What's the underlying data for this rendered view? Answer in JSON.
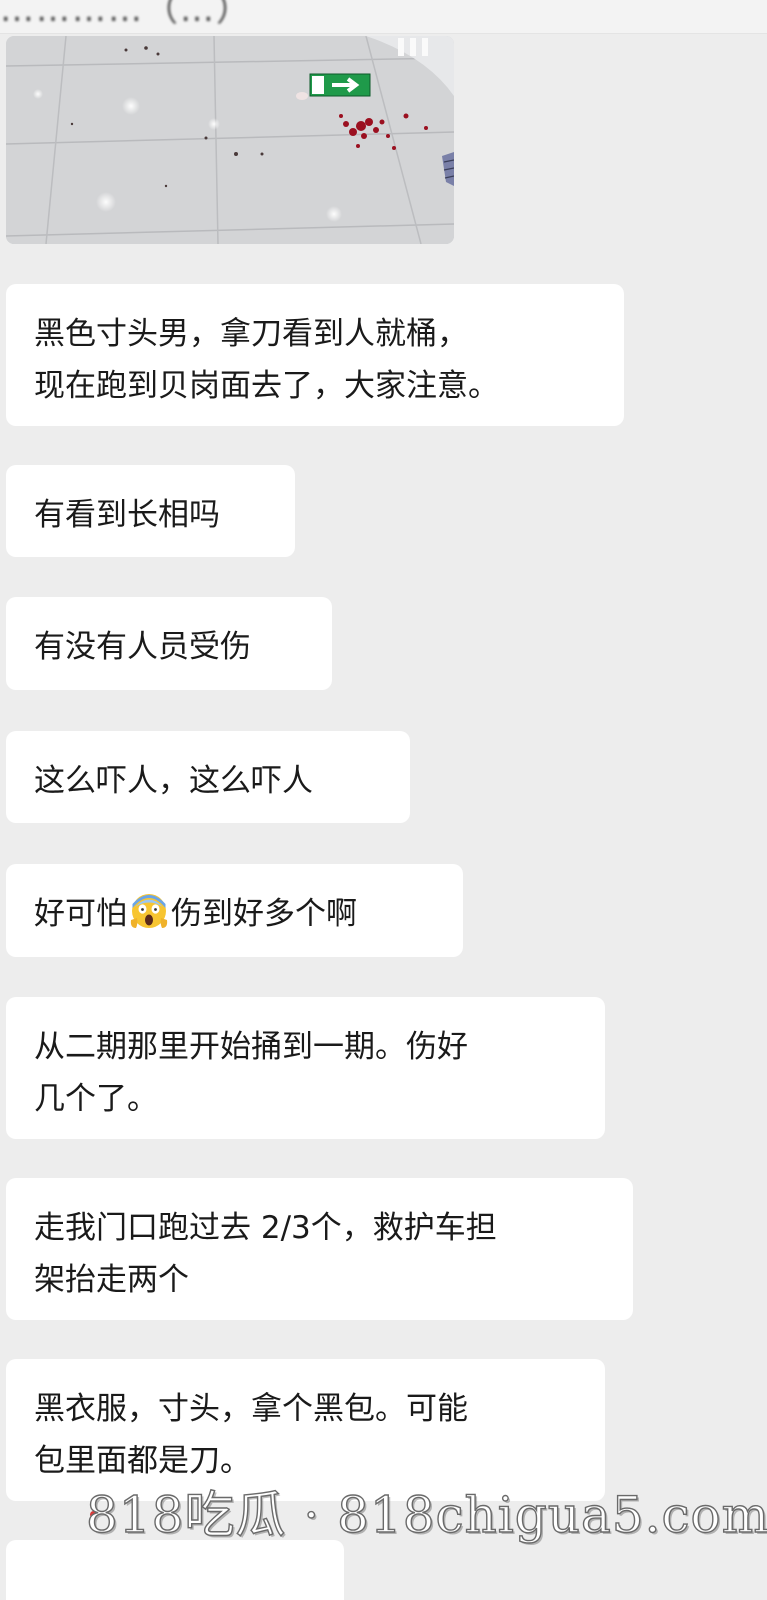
{
  "header": {
    "title_cut": "…………（…）"
  },
  "photo": {
    "alt": ""
  },
  "messages": [
    {
      "lines": [
        "黑色寸头男，拿刀看到人就桶，",
        "现在跑到贝岗面去了，大家注意。"
      ]
    },
    {
      "lines": [
        "有看到长相吗"
      ]
    },
    {
      "lines": [
        "有没有人员受伤"
      ]
    },
    {
      "lines": [
        "这么吓人，这么吓人"
      ]
    },
    {
      "before_emoji": "好可怕",
      "emoji": "scream-emoji-icon",
      "after_emoji": "伤到好多个啊"
    },
    {
      "lines": [
        "从二期那里开始捅到一期。伤好",
        "几个了。"
      ]
    },
    {
      "lines": [
        "走我门口跑过去 2/3个，救护车担",
        "架抬走两个"
      ]
    },
    {
      "lines": [
        "黑衣服，寸头，拿个黑包。可能",
        "包里面都是刀。"
      ]
    }
  ],
  "watermark": {
    "text": "818吃瓜 · 818chigua5.com"
  },
  "colors": {
    "background": "#ededed",
    "bubble": "#ffffff",
    "text": "#1a1a1a",
    "exit_sign": "#1f9a4a",
    "blood": "#9b1020"
  }
}
